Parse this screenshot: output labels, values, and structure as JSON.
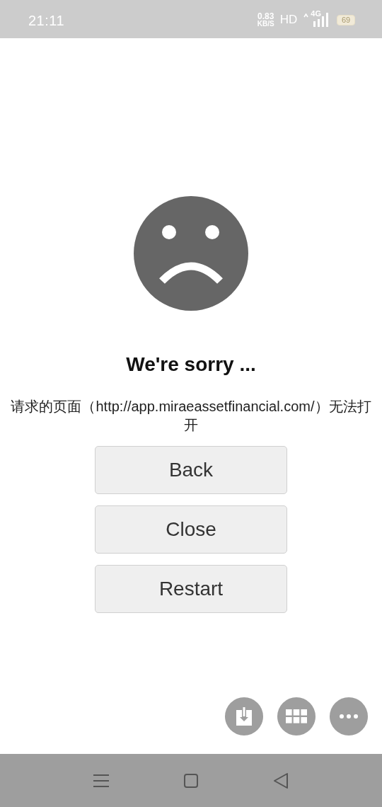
{
  "status_bar": {
    "time": "21:11",
    "speed": "0.83",
    "speed_unit": "KB/S",
    "hd": "HD",
    "network": "4G",
    "battery": "69"
  },
  "error": {
    "title": "We're sorry ...",
    "message": "请求的页面（http://app.miraeassetfinancial.com/）无法打开"
  },
  "buttons": [
    "Back",
    "Close",
    "Restart"
  ],
  "fabs": [
    {
      "kind": "download"
    },
    {
      "kind": "grid"
    },
    {
      "kind": "more"
    }
  ],
  "nav_bar": [
    {
      "kind": "menu"
    },
    {
      "kind": "home"
    },
    {
      "kind": "back"
    }
  ]
}
